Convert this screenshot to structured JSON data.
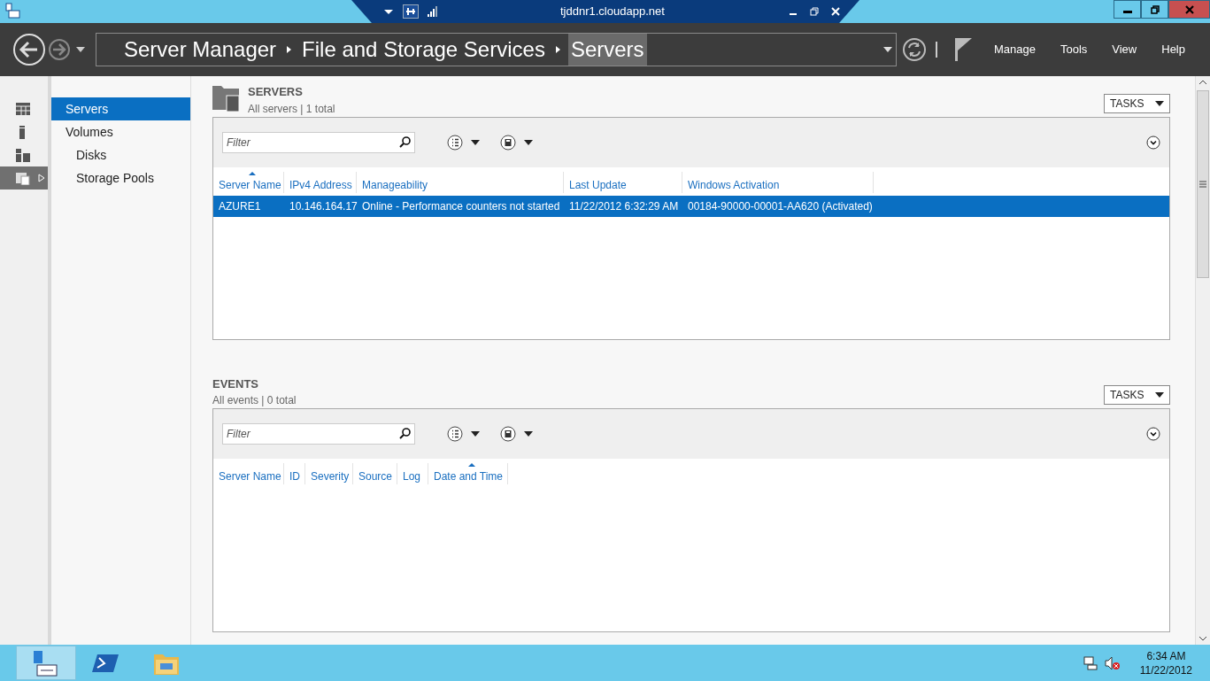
{
  "title_bar": {
    "connection_title": "tjddnr1.cloudapp.net"
  },
  "header": {
    "breadcrumb": [
      {
        "label": "Server Manager",
        "selected": false
      },
      {
        "label": "File and Storage Services",
        "selected": false
      },
      {
        "label": "Servers",
        "selected": true
      }
    ],
    "menu": [
      "Manage",
      "Tools",
      "View",
      "Help"
    ]
  },
  "sidebar_icons": [
    {
      "kind": "dashboard",
      "selected": false
    },
    {
      "kind": "server",
      "selected": false
    },
    {
      "kind": "servers",
      "selected": false
    },
    {
      "kind": "storage",
      "selected": true
    }
  ],
  "nav": {
    "items": [
      {
        "label": "Servers",
        "selected": true
      },
      {
        "label": "Volumes",
        "selected": false,
        "children": [
          {
            "label": "Disks",
            "selected": false
          },
          {
            "label": "Storage Pools",
            "selected": false
          }
        ]
      }
    ]
  },
  "sections": [
    {
      "title": "SERVERS",
      "subtitle": "All servers | 1 total",
      "tasks": "TASKS",
      "filter": {
        "placeholder": "Filter"
      },
      "columns": [
        {
          "label": "Server Name",
          "sorted": true
        },
        {
          "label": "IPv4 Address",
          "sorted": false
        },
        {
          "label": "Manageability",
          "sorted": false
        },
        {
          "label": "Last Update",
          "sorted": false
        },
        {
          "label": "Windows Activation",
          "sorted": false
        }
      ],
      "rows": [
        {
          "selected": true,
          "cells": [
            "AZURE1",
            "10.146.164.17",
            "Online - Performance counters not started",
            "11/22/2012 6:32:29 AM",
            "00184-90000-00001-AA620 (Activated)"
          ]
        }
      ]
    },
    {
      "title": "EVENTS",
      "subtitle": "All events | 0 total",
      "tasks": "TASKS",
      "filter": {
        "placeholder": "Filter"
      },
      "columns": [
        {
          "label": "Server Name",
          "sorted": false
        },
        {
          "label": "ID",
          "sorted": false
        },
        {
          "label": "Severity",
          "sorted": false
        },
        {
          "label": "Source",
          "sorted": false
        },
        {
          "label": "Log",
          "sorted": false
        },
        {
          "label": "Date and Time",
          "sorted": true
        }
      ]
    }
  ],
  "taskbar": {
    "apps": [
      {
        "kind": "server-manager",
        "selected": true
      },
      {
        "kind": "powershell",
        "selected": false
      },
      {
        "kind": "explorer",
        "selected": false
      }
    ],
    "time": "6:34 AM",
    "date": "11/22/2012"
  }
}
